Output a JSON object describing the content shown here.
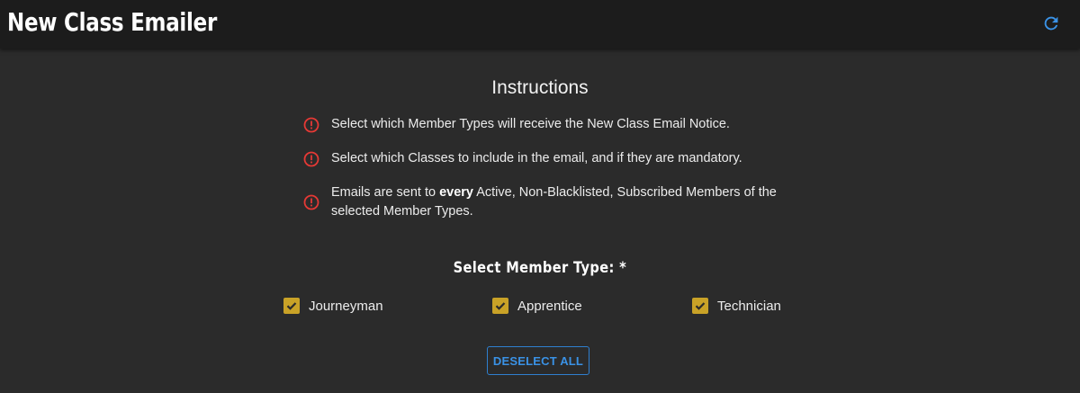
{
  "header": {
    "title": "New Class Emailer",
    "refresh_icon": "refresh-icon"
  },
  "instructions": {
    "heading": "Instructions",
    "icon": "alert-circle-icon",
    "icon_color": "#e53935",
    "items": [
      {
        "text": "Select which Member Types will receive the New Class Email Notice."
      },
      {
        "text": "Select which Classes to include in the email, and if they are mandatory."
      },
      {
        "before": "Emails are sent to ",
        "bold": "every",
        "after": " Active, Non-Blacklisted, Subscribed Members of the selected Member Types."
      }
    ]
  },
  "member_type": {
    "title": "Select Member Type: *",
    "options": [
      {
        "label": "Journeyman",
        "checked": true
      },
      {
        "label": "Apprentice",
        "checked": true
      },
      {
        "label": "Technician",
        "checked": true
      }
    ],
    "checkbox_color": "#c9a227"
  },
  "actions": {
    "deselect_all": "DESELECT ALL",
    "accent": "#3a92e6"
  }
}
